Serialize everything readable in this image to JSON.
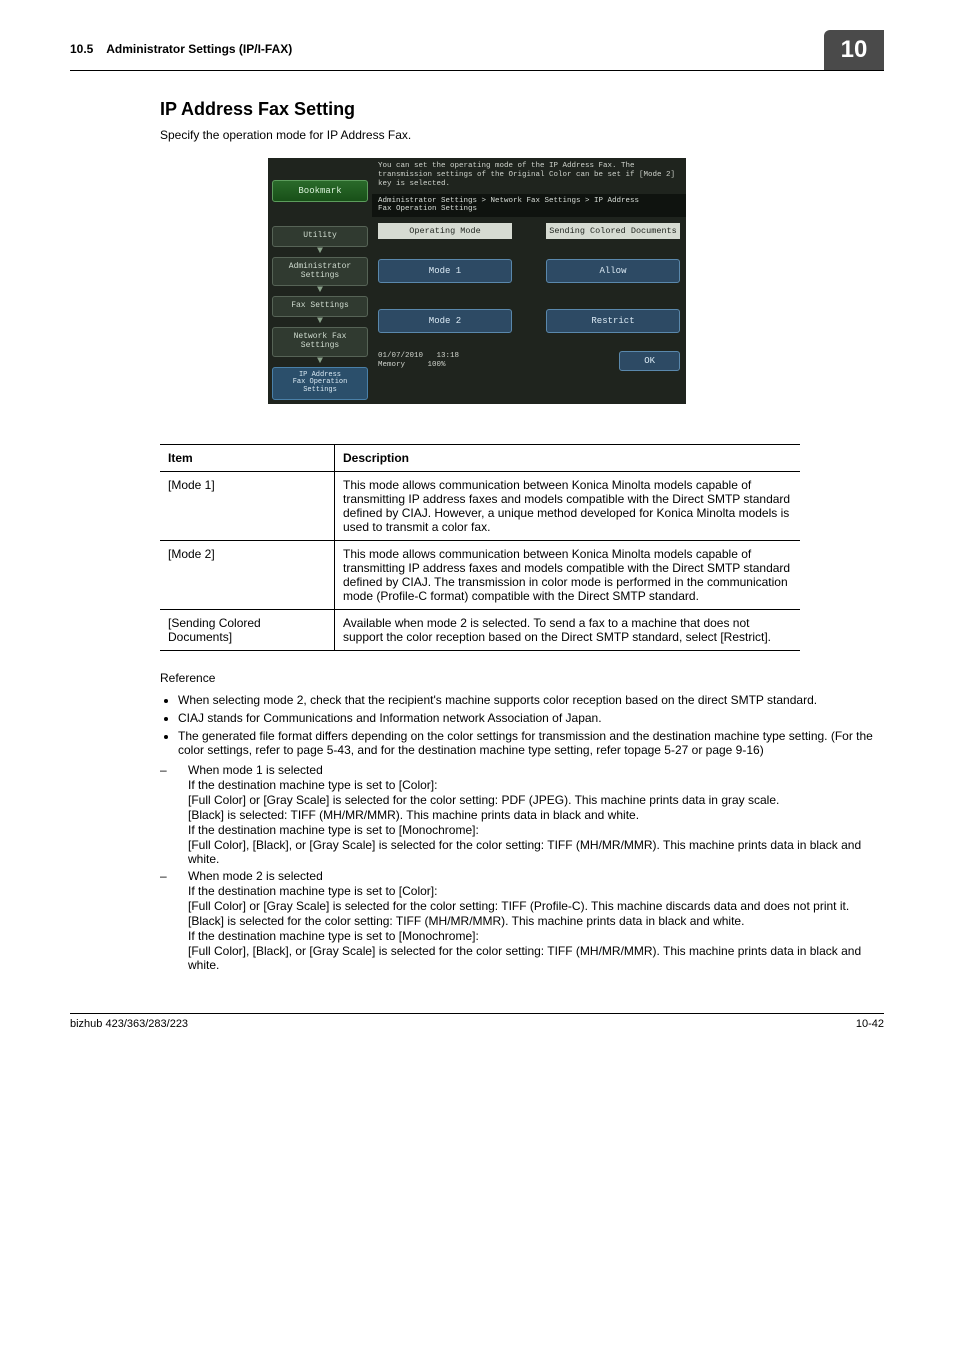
{
  "header": {
    "section_no": "10.5",
    "section_title": "Administrator Settings (IP/I-FAX)",
    "chapter_no": "10"
  },
  "title": "IP Address Fax Setting",
  "intro": "Specify the operation mode for IP Address Fax.",
  "screenshot": {
    "bookmark": "Bookmark",
    "breadcrumbs": [
      "Utility",
      "Administrator\nSettings",
      "Fax Settings",
      "Network Fax\nSettings",
      "IP Address\nFax Operation\nSettings"
    ],
    "message": "You can set the operating mode of the IP Address Fax. The transmission settings of the Original Color can be set if [Mode 2] key is selected.",
    "path": "Administrator Settings > Network Fax Settings > IP Address\nFax Operation Settings",
    "col1": "Operating Mode",
    "col2": "Sending Colored Documents",
    "mode1": "Mode 1",
    "mode2": "Mode 2",
    "allow": "Allow",
    "restrict": "Restrict",
    "date": "01/07/2010",
    "time": "13:18",
    "memory": "Memory",
    "mempct": "100%",
    "ok": "OK"
  },
  "table": {
    "h1": "Item",
    "h2": "Description",
    "rows": [
      {
        "item": "[Mode 1]",
        "desc": "This mode allows communication between Konica Minolta models capable of transmitting IP address faxes and models compatible with the Direct SMTP standard defined by CIAJ. However, a unique method developed for Konica Minolta models is used to transmit a color fax."
      },
      {
        "item": "[Mode 2]",
        "desc": "This mode allows communication between Konica Minolta models capable of transmitting IP address faxes and models compatible with the Direct SMTP standard defined by CIAJ. The transmission in color mode is performed in the communication mode (Profile-C format) compatible with the Direct SMTP standard."
      },
      {
        "item": "[Sending Colored Documents]",
        "desc": "Available when mode 2 is selected. To send a fax to a machine that does not support the color reception based on the Direct SMTP standard, select [Restrict]."
      }
    ]
  },
  "reference": {
    "label": "Reference",
    "bullets": [
      "When selecting mode 2, check that the recipient's machine supports color reception based on the direct SMTP standard.",
      "CIAJ stands for Communications and Information network Association of Japan.",
      "The generated file format differs depending on the color settings for transmission and the destination machine type setting. (For the color settings, refer to page 5-43, and for the destination machine type setting, refer topage 5-27 or page 9-16)"
    ],
    "dash1": {
      "head": "When mode 1 is selected",
      "lines": [
        "If the destination machine type is set to [Color]:",
        "[Full Color] or [Gray Scale] is selected for the color setting: PDF (JPEG). This machine prints data in gray scale.",
        "[Black] is selected: TIFF (MH/MR/MMR). This machine prints data in black and white.",
        "If the destination machine type is set to [Monochrome]:",
        "[Full Color], [Black], or [Gray Scale] is selected for the color setting: TIFF (MH/MR/MMR). This machine prints data in black and white."
      ]
    },
    "dash2": {
      "head": "When mode 2 is selected",
      "lines": [
        "If the destination machine type is set to [Color]:",
        "[Full Color] or [Gray Scale] is selected for the color setting: TIFF (Profile-C). This machine discards data and does not print it.",
        "[Black] is selected for the color setting: TIFF (MH/MR/MMR). This machine prints data in black and white.",
        "If the destination machine type is set to [Monochrome]:",
        "[Full Color], [Black], or [Gray Scale] is selected for the color setting: TIFF (MH/MR/MMR). This machine prints data in black and white."
      ]
    }
  },
  "footer": {
    "product": "bizhub 423/363/283/223",
    "page": "10-42"
  }
}
